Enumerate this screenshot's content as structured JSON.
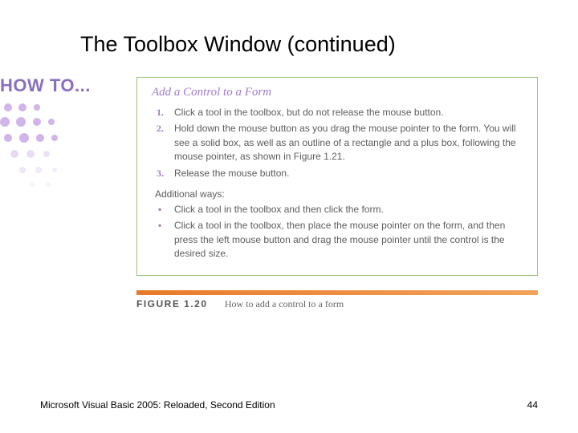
{
  "title": "The Toolbox Window (continued)",
  "howto_label": "HOW TO...",
  "panel": {
    "title": "Add a Control to a Form",
    "steps": [
      "Click a tool in the toolbox, but do not release the mouse button.",
      "Hold down the mouse button as you drag the mouse pointer to the form. You will see a solid box, as well as an outline of a rectangle and a plus box, following the mouse pointer, as shown in Figure 1.21.",
      "Release the mouse button."
    ],
    "subhead": "Additional ways:",
    "bullets": [
      "Click a tool in the toolbox and then click the form.",
      "Click a tool in the toolbox, then place the mouse pointer on the form, and then press the left mouse button and drag the mouse pointer until the control is the desired size."
    ]
  },
  "figure": {
    "label": "FIGURE 1.20",
    "caption": "How to add a control to a form"
  },
  "footer": {
    "left": "Microsoft Visual Basic 2005: Reloaded, Second Edition",
    "right": "44"
  }
}
